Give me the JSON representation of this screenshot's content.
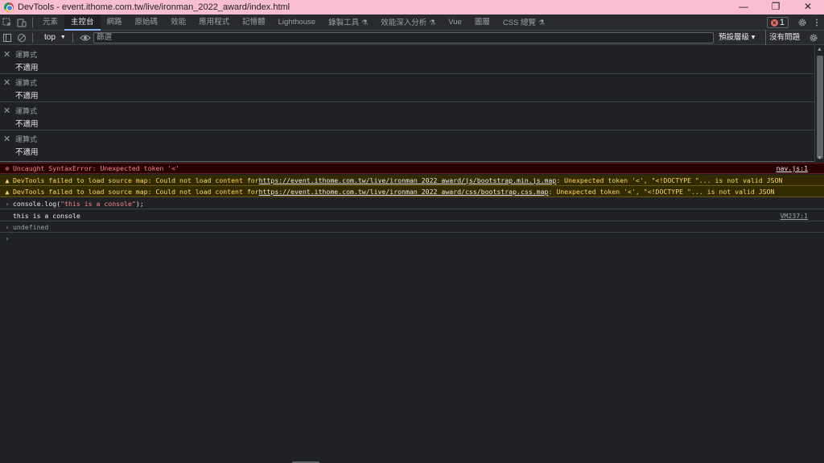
{
  "window": {
    "title": "DevTools - event.ithome.com.tw/live/ironman_2022_award/index.html",
    "controls": {
      "minimize": "—",
      "restore": "❐",
      "close": "✕"
    }
  },
  "tabs": [
    {
      "label": "元素"
    },
    {
      "label": "主控台",
      "active": true
    },
    {
      "label": "網路"
    },
    {
      "label": "原始碼"
    },
    {
      "label": "效能"
    },
    {
      "label": "應用程式"
    },
    {
      "label": "記憶體"
    },
    {
      "label": "Lighthouse"
    },
    {
      "label": "錄製工具"
    },
    {
      "label": "效能深入分析"
    },
    {
      "label": "Vue"
    },
    {
      "label": "圖層"
    },
    {
      "label": "CSS 總覽"
    }
  ],
  "error_badge": {
    "count": "1"
  },
  "toolbar": {
    "context": "top",
    "filter_placeholder": "篩選",
    "levels": "預設層級 ▾",
    "issues": "沒有問題"
  },
  "live_expressions": [
    {
      "label": "運算式",
      "value": "不適用"
    },
    {
      "label": "運算式",
      "value": "不適用"
    },
    {
      "label": "運算式",
      "value": "不適用"
    },
    {
      "label": "運算式",
      "value": "不適用"
    }
  ],
  "messages": {
    "error": {
      "text": "Uncaught SyntaxError: Unexpected token '<'",
      "source": "nav.js:1"
    },
    "warn1": {
      "prefix": "DevTools failed to load source map: Could not load content for ",
      "url": "https://event.ithome.com.tw/live/ironman_2022_award/js/bootstrap.min.js.map",
      "suffix": ": Unexpected token '<', \"<!DOCTYPE \"... is not valid JSON"
    },
    "warn2": {
      "prefix": "DevTools failed to load source map: Could not load content for ",
      "url": "https://event.ithome.com.tw/live/ironman_2022_award/css/bootstrap.css.map",
      "suffix": ": Unexpected token '<', \"<!DOCTYPE \"... is not valid JSON"
    },
    "input": {
      "pre": "console.log(",
      "str": "\"this is a console\"",
      "post": ");"
    },
    "log": {
      "text": "this is a console",
      "source": "VM237:1"
    },
    "result": {
      "text": "undefined"
    }
  },
  "colors": {
    "titlebar": "#f9bfd1",
    "error_bg": "#290000",
    "warning_bg": "#332b00",
    "accent": "#8ab4f8"
  }
}
